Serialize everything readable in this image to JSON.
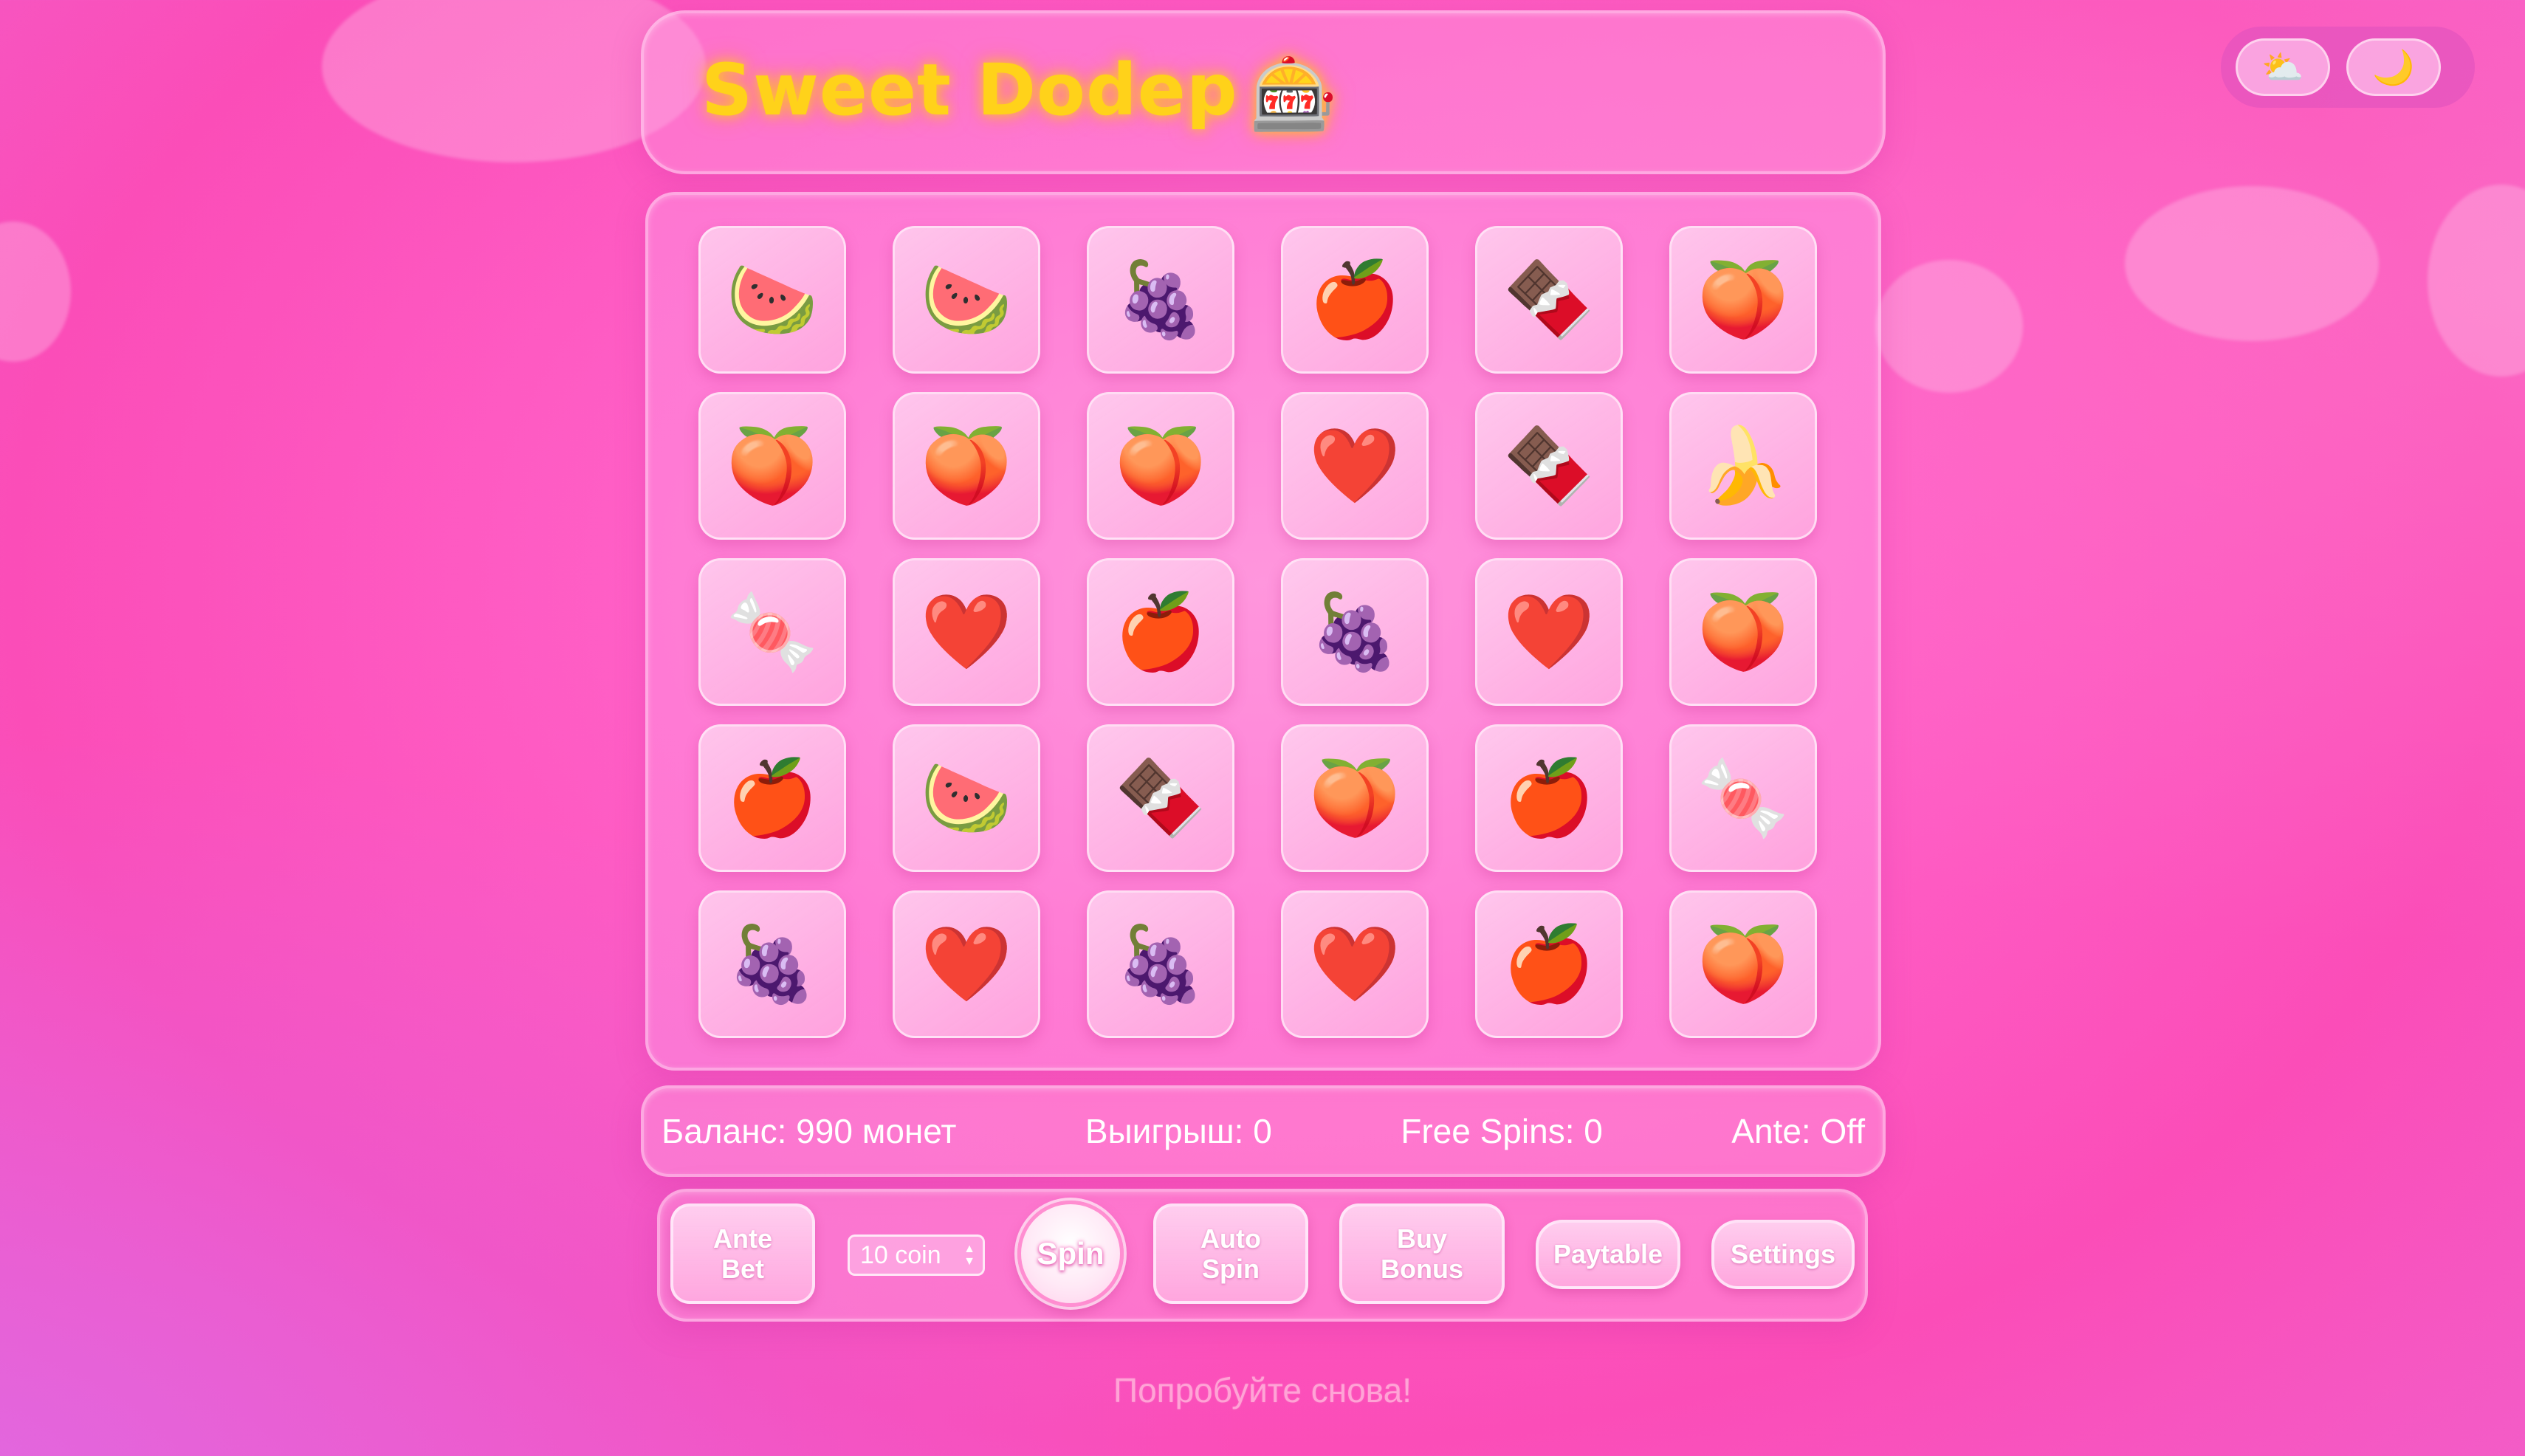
{
  "header": {
    "title": "Sweet Dodep",
    "title_icon": "🎰",
    "title_icon_name": "slot-machine-icon",
    "title_color": "#ffd21a"
  },
  "theme_switch": {
    "light": {
      "icon": "⛅",
      "icon_name": "sun-behind-cloud-icon"
    },
    "dark": {
      "icon": "🌙",
      "icon_name": "crescent-moon-icon"
    }
  },
  "grid": {
    "rows": 5,
    "cols": 6,
    "cells": [
      [
        "🍉",
        "🍉",
        "🍇",
        "🍎",
        "🍫",
        "🍑"
      ],
      [
        "🍑",
        "🍑",
        "🍑",
        "❤️",
        "🍫",
        "🍌"
      ],
      [
        "🍬",
        "❤️",
        "🍎",
        "🍇",
        "❤️",
        "🍑"
      ],
      [
        "🍎",
        "🍉",
        "🍫",
        "🍑",
        "🍎",
        "🍬"
      ],
      [
        "🍇",
        "❤️",
        "🍇",
        "❤️",
        "🍎",
        "🍑"
      ]
    ],
    "cell_names": [
      [
        "watermelon-icon",
        "watermelon-icon",
        "grapes-icon",
        "apple-icon",
        "chocolate-icon",
        "peach-icon"
      ],
      [
        "peach-icon",
        "peach-icon",
        "peach-icon",
        "heart-icon",
        "chocolate-icon",
        "banana-icon"
      ],
      [
        "candy-icon",
        "heart-icon",
        "apple-icon",
        "grapes-icon",
        "heart-icon",
        "peach-icon"
      ],
      [
        "apple-icon",
        "watermelon-icon",
        "chocolate-icon",
        "peach-icon",
        "apple-icon",
        "candy-icon"
      ],
      [
        "grapes-icon",
        "heart-icon",
        "grapes-icon",
        "heart-icon",
        "apple-icon",
        "peach-icon"
      ]
    ]
  },
  "stats": {
    "balance": "Баланс: 990 монет",
    "win": "Выигрыш: 0",
    "free_spins": "Free Spins: 0",
    "ante": "Ante: Off"
  },
  "controls": {
    "ante_bet": [
      "Ante",
      "Bet"
    ],
    "bet_select": "10 coin",
    "spin": "Spin",
    "auto_spin": [
      "Auto",
      "Spin"
    ],
    "buy_bonus": [
      "Buy",
      "Bonus"
    ],
    "paytable": "Paytable",
    "settings": "Settings"
  },
  "message": "Попробуйте снова!",
  "colors": {
    "background": "#fb4db8",
    "panel": "#ffa0e1",
    "text": "#ffffff"
  }
}
